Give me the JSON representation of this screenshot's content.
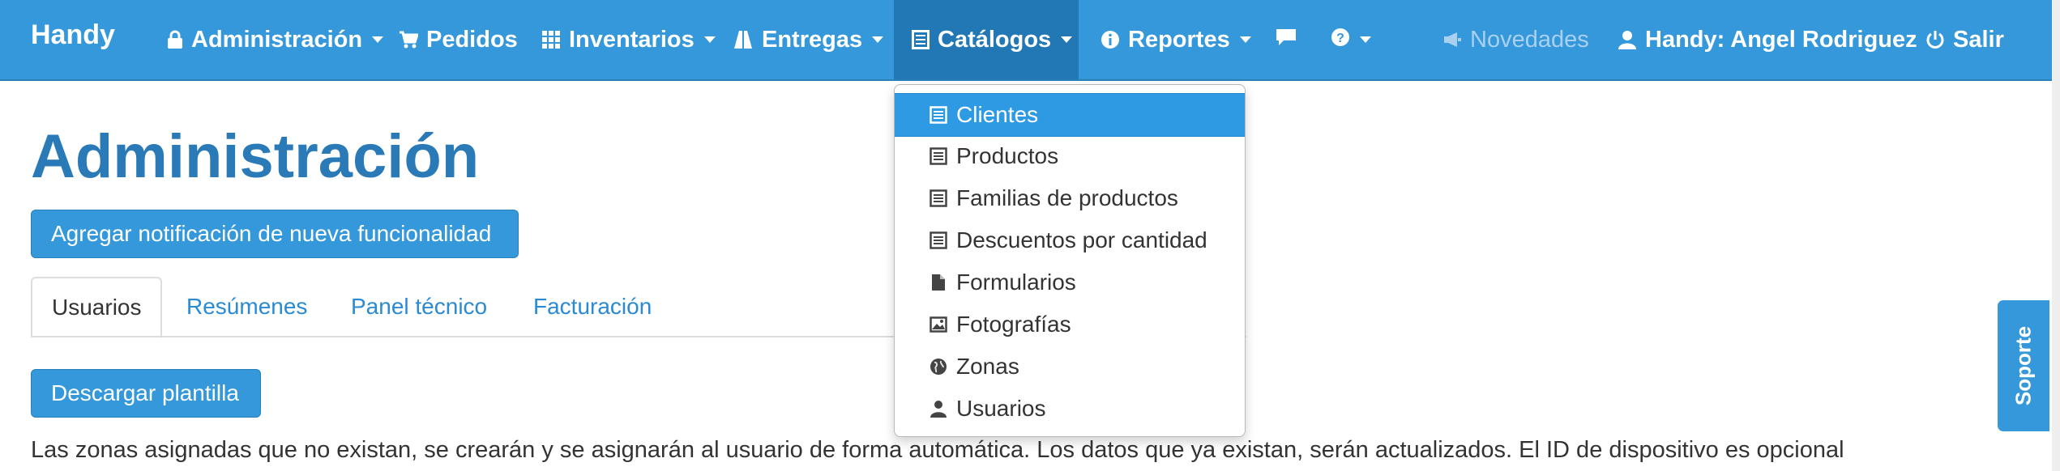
{
  "app": {
    "brand": "Handy"
  },
  "nav": {
    "administracion": "Administración",
    "pedidos": "Pedidos",
    "inventarios": "Inventarios",
    "entregas": "Entregas",
    "catalogos": "Catálogos",
    "reportes": "Reportes",
    "novedades": "Novedades",
    "user": "Handy: Angel Rodriguez",
    "salir": "Salir"
  },
  "dropdown": {
    "items": [
      {
        "label": "Clientes",
        "icon": "list-icon"
      },
      {
        "label": "Productos",
        "icon": "list-icon"
      },
      {
        "label": "Familias de productos",
        "icon": "list-icon"
      },
      {
        "label": "Descuentos por cantidad",
        "icon": "list-icon"
      },
      {
        "label": "Formularios",
        "icon": "file-icon"
      },
      {
        "label": "Fotografías",
        "icon": "picture-icon"
      },
      {
        "label": "Zonas",
        "icon": "globe-icon"
      },
      {
        "label": "Usuarios",
        "icon": "user-icon"
      }
    ]
  },
  "main": {
    "title": "Administración",
    "add_notification_button": "Agregar notificación de nueva funcionalidad",
    "tabs": [
      {
        "label": "Usuarios"
      },
      {
        "label": "Resúmenes"
      },
      {
        "label": "Panel técnico"
      },
      {
        "label": "Facturación"
      }
    ],
    "download_button": "Descargar plantilla",
    "info_text": "Las zonas asignadas que no existan, se crearán y se asignarán al usuario de forma automática. Los datos que ya existan, serán actualizados. El ID de dispositivo es opcional"
  },
  "support": {
    "label": "Soporte"
  },
  "colors": {
    "primary": "#3498db",
    "active_nav": "#2178b5",
    "title": "#2a7ab8",
    "link": "#2a8ad3"
  }
}
